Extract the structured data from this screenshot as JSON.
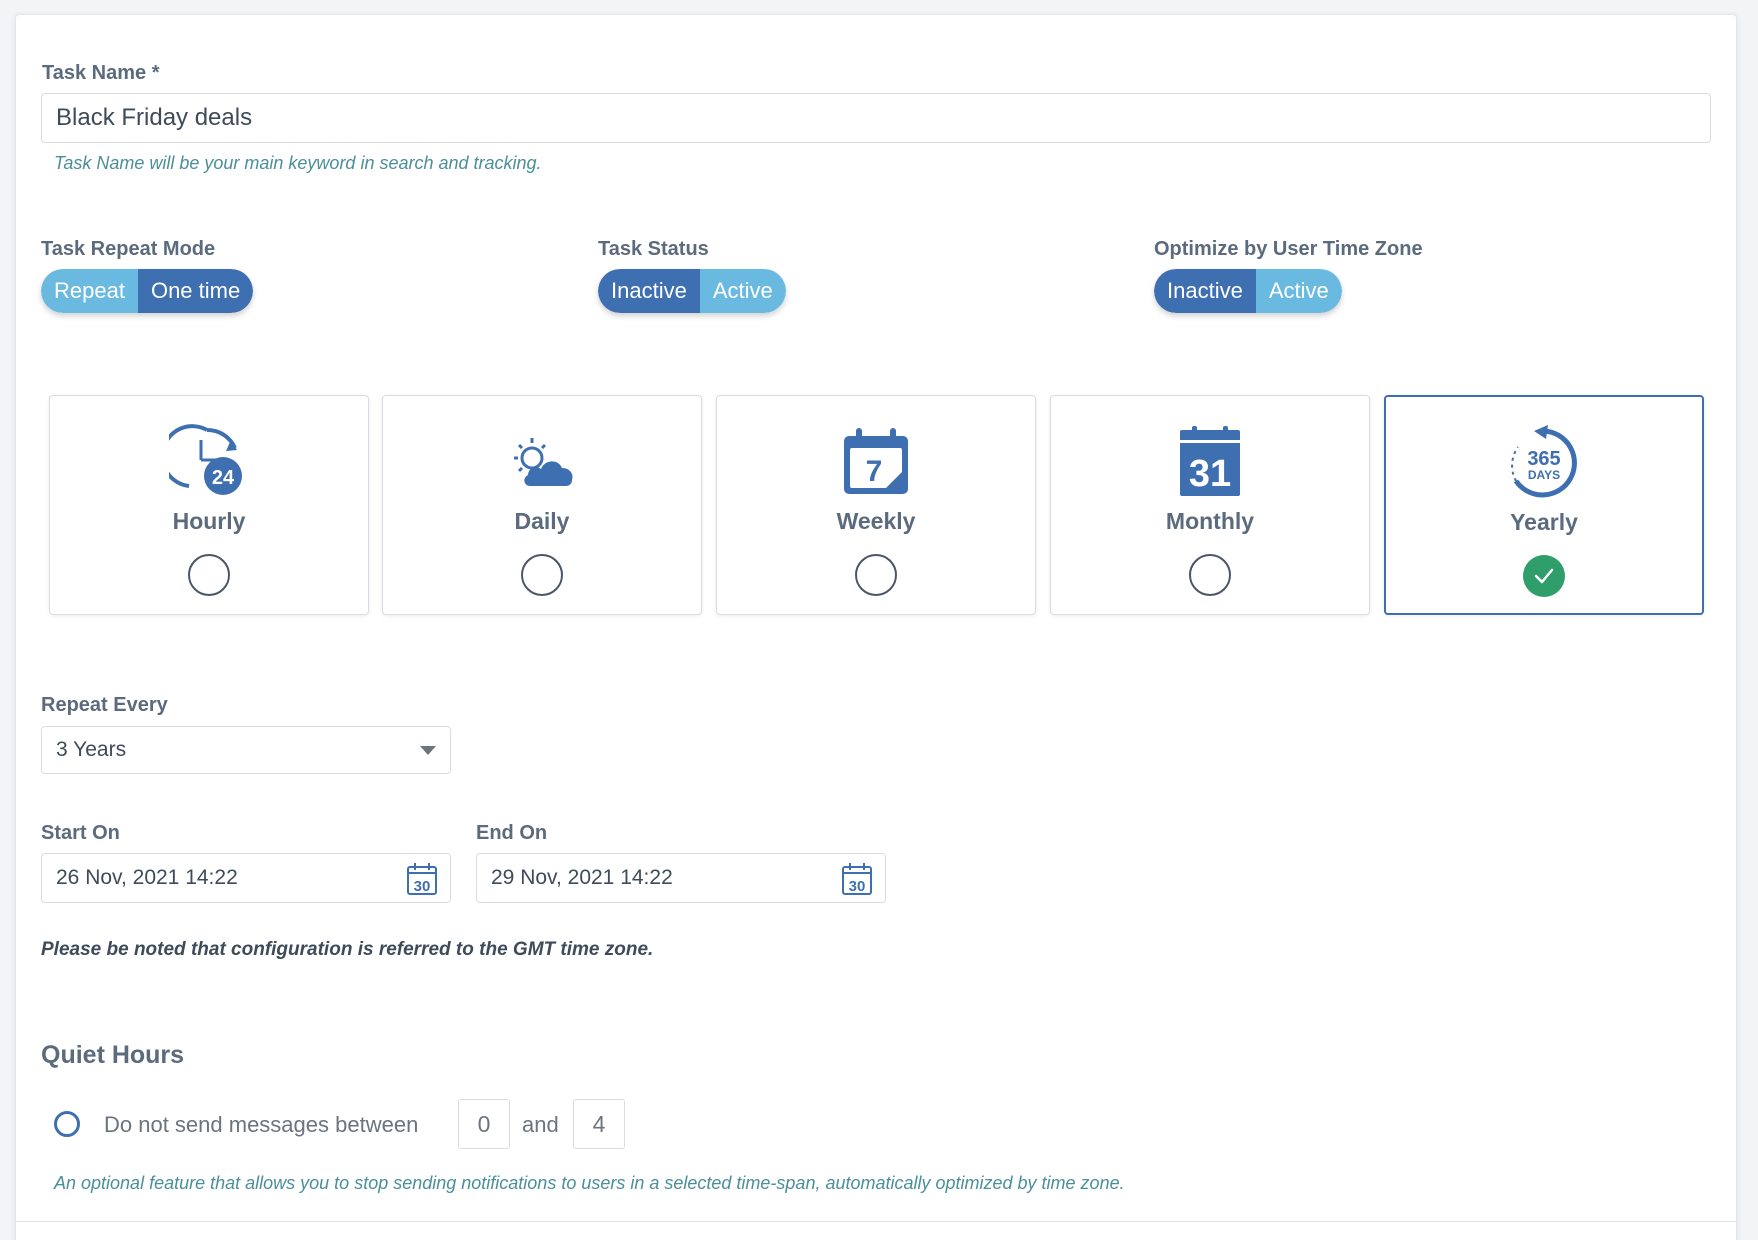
{
  "task_name": {
    "label": "Task Name *",
    "value": "Black Friday deals",
    "hint": "Task Name will be your main keyword in search and tracking."
  },
  "repeat_mode": {
    "label": "Task Repeat Mode",
    "options": [
      "Repeat",
      "One time"
    ],
    "selected": "One time"
  },
  "task_status": {
    "label": "Task Status",
    "options": [
      "Inactive",
      "Active"
    ],
    "selected": "Inactive"
  },
  "optimize_tz": {
    "label": "Optimize by User Time Zone",
    "options": [
      "Inactive",
      "Active"
    ],
    "selected": "Inactive"
  },
  "frequencies": [
    {
      "name": "Hourly",
      "icon": "clock-24-icon",
      "selected": false
    },
    {
      "name": "Daily",
      "icon": "sun-cloud-icon",
      "selected": false
    },
    {
      "name": "Weekly",
      "icon": "calendar-7-icon",
      "selected": false
    },
    {
      "name": "Monthly",
      "icon": "calendar-31-icon",
      "selected": false
    },
    {
      "name": "Yearly",
      "icon": "365-days-icon",
      "selected": true
    }
  ],
  "icon_text": {
    "hourly": "24",
    "weekly": "7",
    "monthly": "31",
    "yearly_top": "365",
    "yearly_bottom": "DAYS",
    "calendar": "30"
  },
  "repeat_every": {
    "label": "Repeat Every",
    "value": "3 Years"
  },
  "start_on": {
    "label": "Start On",
    "value": "26 Nov, 2021 14:22"
  },
  "end_on": {
    "label": "End On",
    "value": "29 Nov, 2021 14:22"
  },
  "gmt_note": "Please be noted that configuration is referred to the GMT time zone.",
  "quiet_hours": {
    "title": "Quiet Hours",
    "text": "Do not send messages between",
    "from": "0",
    "conj": "and",
    "to": "4",
    "hint": "An optional feature that allows you to stop sending notifications to users in a selected time-span, automatically optimized by time zone."
  },
  "colors": {
    "primary": "#3e6fb1",
    "light": "#6ab9e0",
    "success": "#2f9e6a",
    "hint": "#4a8f9a"
  }
}
